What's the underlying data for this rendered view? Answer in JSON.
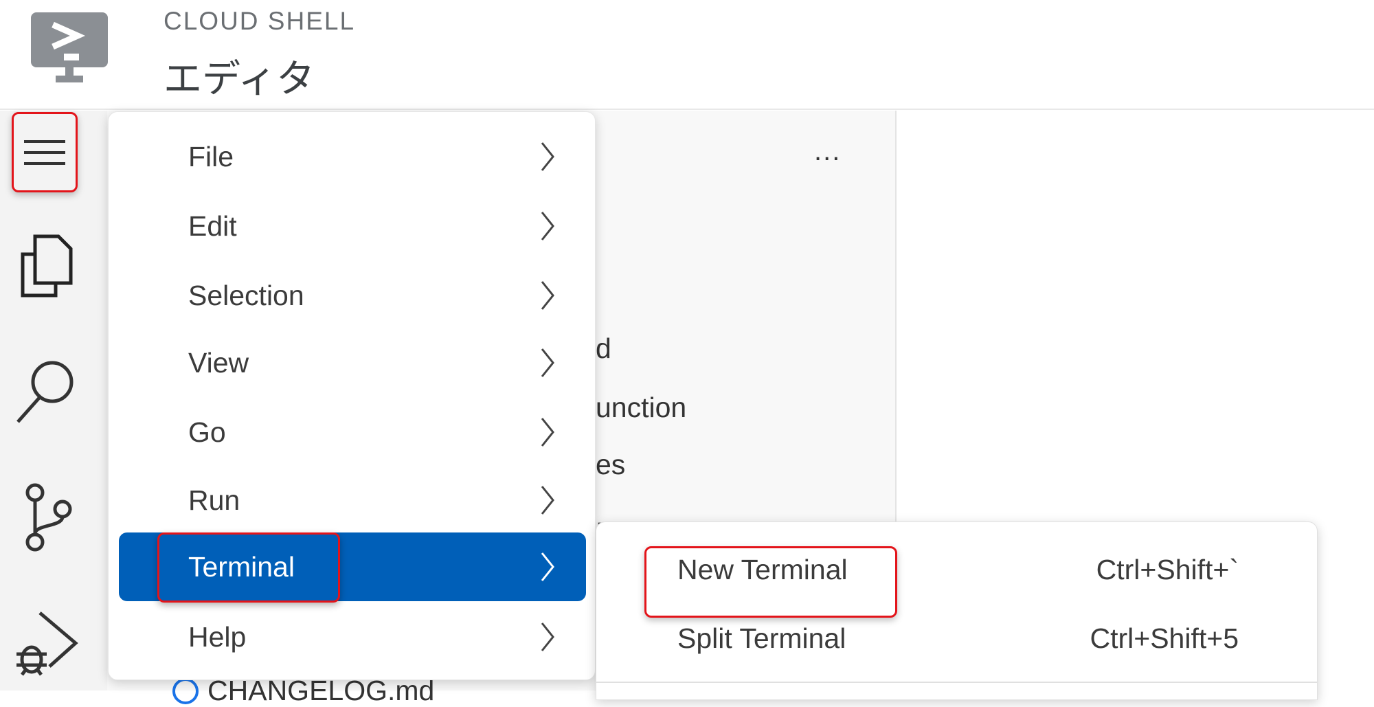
{
  "header": {
    "brand": "CLOUD SHELL",
    "title": "エディタ",
    "logo_icon": "terminal-monitor-icon"
  },
  "activity_bar": {
    "items": [
      "menu-icon",
      "explorer-icon",
      "search-icon",
      "source-control-icon",
      "run-debug-icon"
    ]
  },
  "sidebar": {
    "more_label": "...",
    "background_text": [
      "d",
      "unction",
      "es",
      "..."
    ],
    "changelog": "CHANGELOG.md"
  },
  "menu": {
    "items": [
      {
        "label": "File"
      },
      {
        "label": "Edit"
      },
      {
        "label": "Selection"
      },
      {
        "label": "View"
      },
      {
        "label": "Go"
      },
      {
        "label": "Run"
      },
      {
        "label": "Terminal",
        "active": true
      },
      {
        "label": "Help"
      }
    ]
  },
  "submenu": {
    "items": [
      {
        "label": "New Terminal",
        "shortcut": "Ctrl+Shift+`"
      },
      {
        "label": "Split Terminal",
        "shortcut": "Ctrl+Shift+5"
      }
    ]
  },
  "colors": {
    "accent": "#005fb8",
    "highlight": "#e3141a"
  }
}
